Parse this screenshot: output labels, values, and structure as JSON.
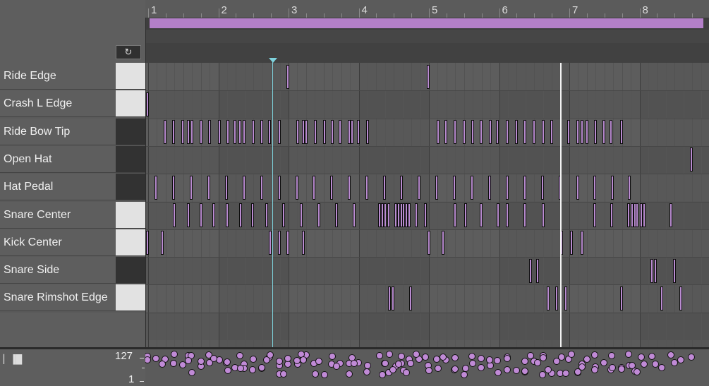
{
  "ruler": {
    "bars": [
      "1",
      "2",
      "3",
      "4",
      "5",
      "6",
      "7",
      "8"
    ]
  },
  "lanes": [
    {
      "label": "Ride Edge",
      "key": "white"
    },
    {
      "label": "Crash L Edge",
      "key": "white"
    },
    {
      "label": "Ride Bow Tip",
      "key": "black"
    },
    {
      "label": "Open Hat",
      "key": "black"
    },
    {
      "label": "Hat Pedal",
      "key": "black"
    },
    {
      "label": "Snare Center",
      "key": "white"
    },
    {
      "label": "Kick Center",
      "key": "white"
    },
    {
      "label": "Snare Side",
      "key": "black"
    },
    {
      "label": "Snare Rimshot Edge",
      "key": "white"
    }
  ],
  "fold_icon": "refresh-icon",
  "velocity": {
    "max_label": "127",
    "min_label": "1",
    "icon": "signal-bars-icon"
  },
  "colors": {
    "note": "#b98bd0",
    "playhead": "#7fd3dd",
    "loop": "#b37fc8"
  }
}
